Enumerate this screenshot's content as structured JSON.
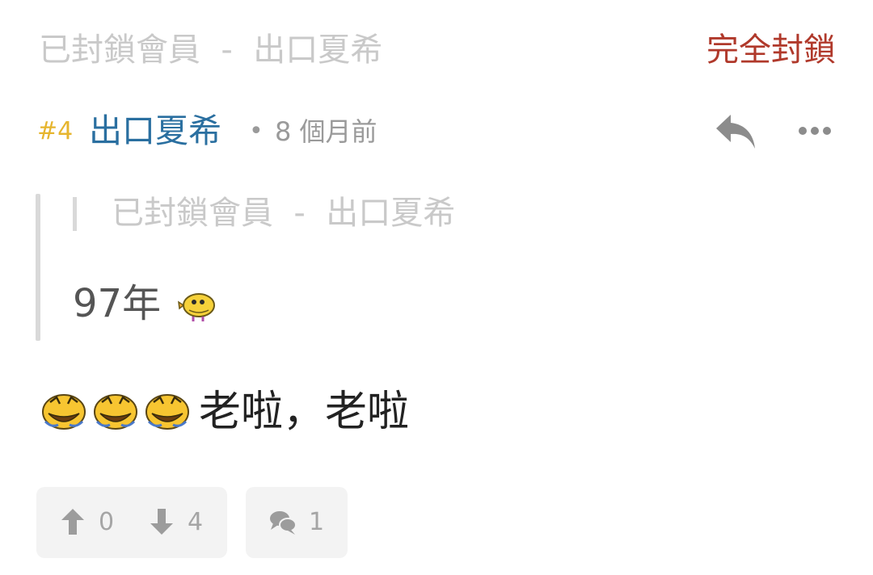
{
  "blocked_header": {
    "label": "已封鎖會員  -  出口夏希",
    "action": "完全封鎖"
  },
  "post": {
    "number": "#4",
    "username": "出口夏希",
    "separator": "•",
    "time": "8 個月前",
    "icons": [
      "reply-icon",
      "more-icon"
    ]
  },
  "quote": {
    "header": "已封鎖會員  -  出口夏希",
    "text": "97年",
    "emoji": "chick-emoji"
  },
  "body": {
    "emojis": [
      "laughing-face-emoji",
      "laughing-face-emoji",
      "laughing-face-emoji"
    ],
    "text": "老啦，老啦"
  },
  "actions": {
    "upvotes": "0",
    "downvotes": "4",
    "comments": "1"
  },
  "colors": {
    "accent_red": "#b0392b",
    "username_blue": "#2a6fa0",
    "post_number_yellow": "#e6b52e",
    "muted_gray": "#c9c9c9"
  }
}
